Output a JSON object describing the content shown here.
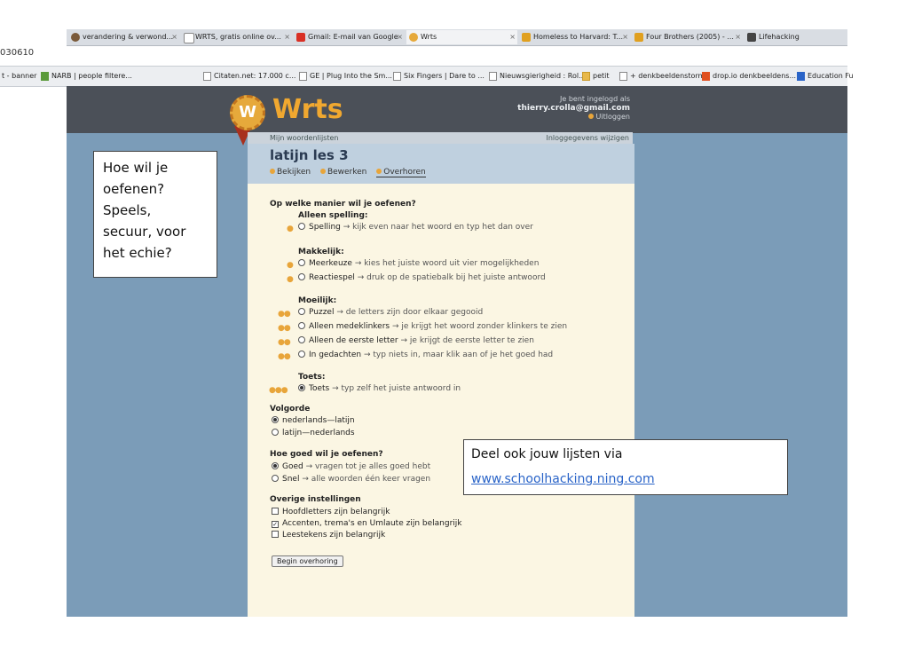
{
  "browser": {
    "tabs": [
      {
        "label": "verandering & verwond...",
        "icon": "avatar-icon",
        "color": "#7a5a3a"
      },
      {
        "label": "WRTS, gratis online ov...",
        "icon": "page-icon",
        "color": "#ffffff"
      },
      {
        "label": "Gmail: E-mail van Google",
        "icon": "gmail-icon",
        "color": "#d93025"
      },
      {
        "label": "Wrts",
        "icon": "wrts-icon",
        "color": "#e6a93b"
      },
      {
        "label": "Homeless to Harvard: T...",
        "icon": "m-icon",
        "color": "#e0a020"
      },
      {
        "label": "Four Brothers (2005) - ...",
        "icon": "m-icon",
        "color": "#e0a020"
      },
      {
        "label": "Lifehacking",
        "icon": "lifehacking-icon",
        "color": "#444444"
      }
    ],
    "url_fragment": "030610",
    "bookmarks": [
      "t - banner",
      "NARB | people filtere...",
      "Citaten.net: 17.000 c...",
      "GE | Plug Into the Sm...",
      "Six Fingers | Dare to ...",
      "Nieuwsgierigheid : Rol...",
      "petit",
      "+ denkbeeldenstorm",
      "drop.io denkbeeldens...",
      "Education Fu"
    ]
  },
  "header": {
    "logo_letter": "W",
    "logo_text": "Wrts",
    "login_label": "Je bent ingelogd als",
    "login_email": "thierry.crolla@gmail.com",
    "logout_label": "Uitloggen"
  },
  "subnav": {
    "left": "Mijn woordenlijsten",
    "right": "Inloggegevens wijzigen"
  },
  "list": {
    "title": "latijn les 3",
    "tabs": [
      "Bekijken",
      "Bewerken",
      "Overhoren"
    ]
  },
  "form": {
    "q_method": "Op welke manier wil je oefenen?",
    "group_spelling": "Alleen spelling:",
    "opt_spelling": {
      "name": "Spelling",
      "desc": "→ kijk even naar het woord en typ het dan over"
    },
    "group_easy": "Makkelijk:",
    "opt_meerkeuze": {
      "name": "Meerkeuze",
      "desc": "→ kies het juiste woord uit vier mogelijkheden"
    },
    "opt_reactiespel": {
      "name": "Reactiespel",
      "desc": "→ druk op de spatiebalk bij het juiste antwoord"
    },
    "group_hard": "Moeilijk:",
    "opt_puzzel": {
      "name": "Puzzel",
      "desc": "→ de letters zijn door elkaar gegooid"
    },
    "opt_medeklinkers": {
      "name": "Alleen medeklinkers",
      "desc": "→ je krijgt het woord zonder klinkers te zien"
    },
    "opt_eerste_letter": {
      "name": "Alleen de eerste letter",
      "desc": "→ je krijgt de eerste letter te zien"
    },
    "opt_gedachten": {
      "name": "In gedachten",
      "desc": "→ typ niets in, maar klik aan of je het goed had"
    },
    "group_test": "Toets:",
    "opt_toets": {
      "name": "Toets",
      "desc": "→ typ zelf het juiste antwoord in"
    },
    "q_order": "Volgorde",
    "order_1": "nederlands—latijn",
    "order_2": "latijn—nederlands",
    "q_how_well": "Hoe goed wil je oefenen?",
    "how_goed": {
      "name": "Goed",
      "desc": "→ vragen tot je alles goed hebt"
    },
    "how_snel": {
      "name": "Snel",
      "desc": "→ alle woorden één keer vragen"
    },
    "q_other": "Overige instellingen",
    "check_hoofdletters": "Hoofdletters zijn belangrijk",
    "check_accenten": "Accenten, trema's en Umlaute zijn belangrijk",
    "check_leestekens": "Leestekens zijn belangrijk",
    "begin_button": "Begin overhoring"
  },
  "notes": {
    "left": "Hoe wil je\noefenen?\nSpeels,\nsecuur, voor\nhet echie?",
    "right_line1": "Deel ook jouw lijsten via",
    "right_link": "www.schoolhacking.ning.com"
  },
  "colors": {
    "accent": "#e8a53a",
    "page_bg": "#7b9cb8",
    "header_bg": "#4b5058",
    "panel_bg": "#fbf6e3"
  }
}
